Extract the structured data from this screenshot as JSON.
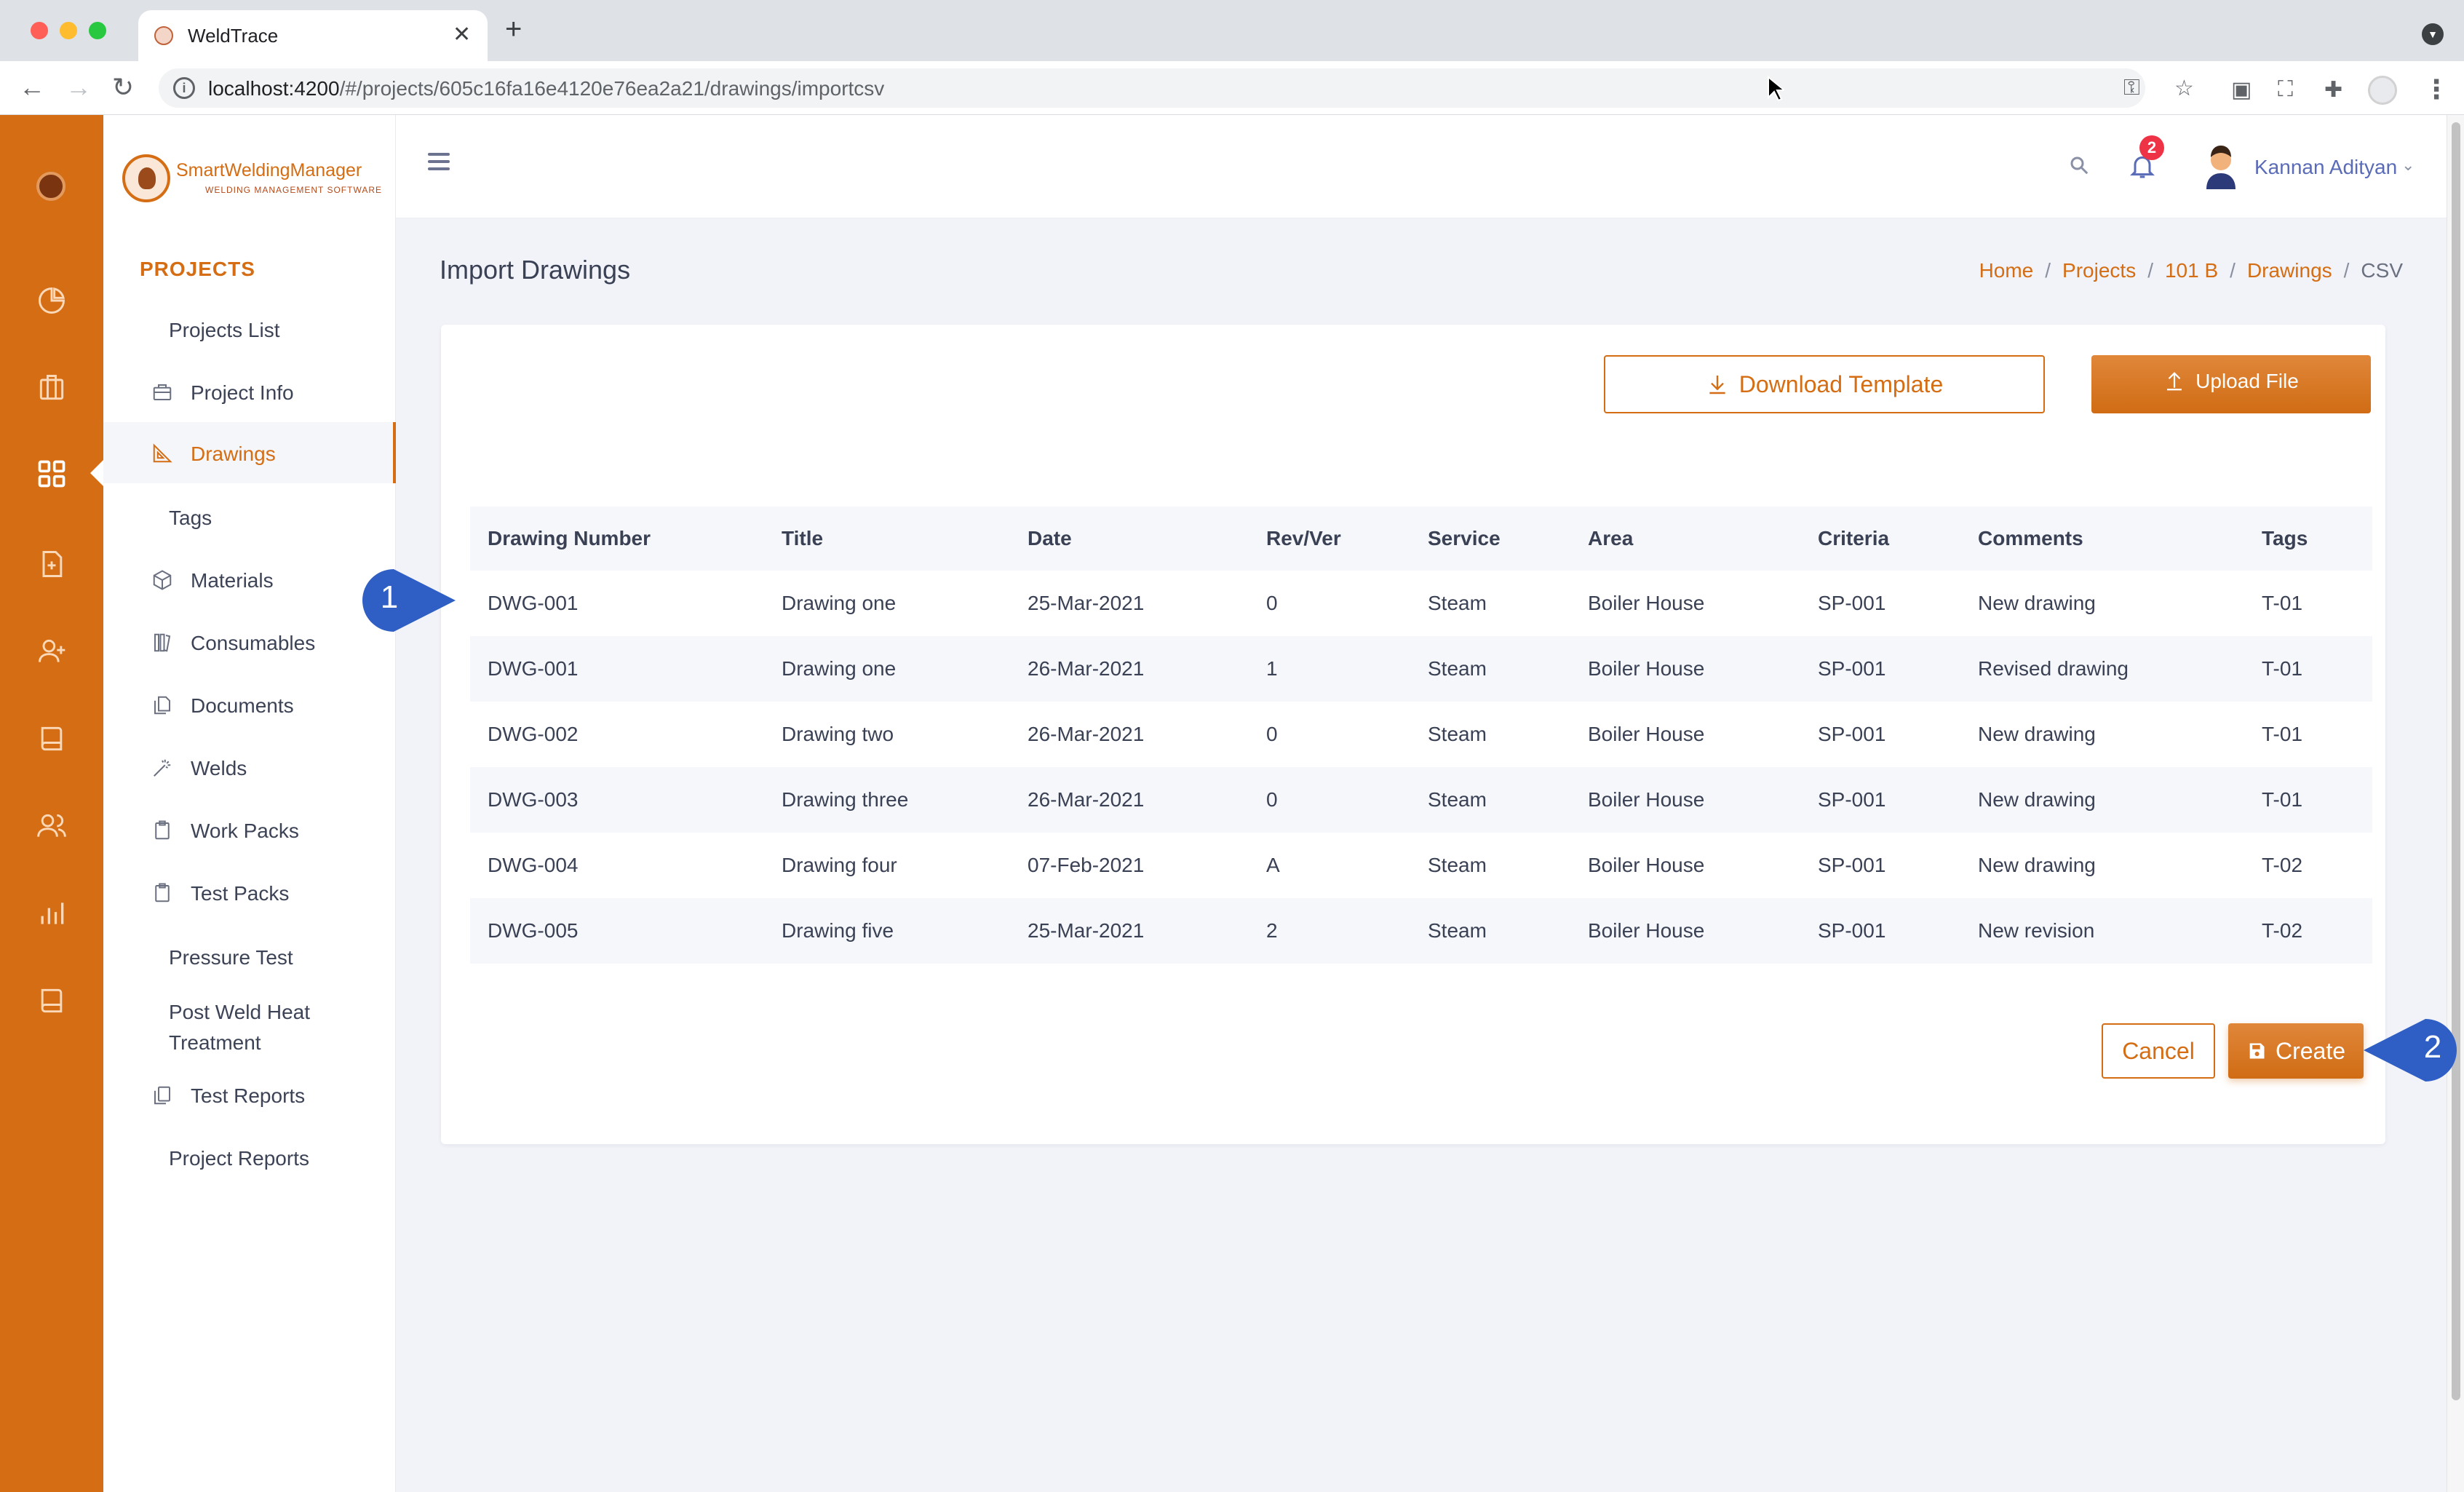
{
  "browser": {
    "tab_title": "WeldTrace",
    "url_host": "localhost:4200",
    "url_path": "/#/projects/605c16fa16e4120e76ea2a21/drawings/importcsv"
  },
  "brand": {
    "name": "SmartWeldingManager",
    "tagline": "WELDING MANAGEMENT SOFTWARE"
  },
  "sidebar": {
    "section_title": "PROJECTS",
    "items": [
      {
        "label": "Projects List",
        "icon": "none"
      },
      {
        "label": "Project Info",
        "icon": "briefcase-icon"
      },
      {
        "label": "Drawings",
        "icon": "ruler-triangle-icon",
        "active": true
      },
      {
        "label": "Tags",
        "icon": "none"
      },
      {
        "label": "Materials",
        "icon": "box-icon"
      },
      {
        "label": "Consumables",
        "icon": "books-icon"
      },
      {
        "label": "Documents",
        "icon": "files-icon"
      },
      {
        "label": "Welds",
        "icon": "magic-wand-icon"
      },
      {
        "label": "Work Packs",
        "icon": "clipboard-icon"
      },
      {
        "label": "Test Packs",
        "icon": "clipboard-icon"
      },
      {
        "label": "Pressure Test",
        "icon": "none"
      },
      {
        "label": "Post Weld Heat Treatment",
        "icon": "none"
      },
      {
        "label": "Test Reports",
        "icon": "copy-icon"
      },
      {
        "label": "Project Reports",
        "icon": "none"
      }
    ]
  },
  "header": {
    "notification_count": "2",
    "user_name": "Kannan Adityan"
  },
  "page": {
    "title": "Import Drawings",
    "breadcrumb": [
      "Home",
      "Projects",
      "101 B",
      "Drawings",
      "CSV"
    ]
  },
  "actions": {
    "download_label": "Download Template",
    "upload_label": "Upload File",
    "cancel_label": "Cancel",
    "create_label": "Create"
  },
  "table": {
    "columns": [
      "Drawing Number",
      "Title",
      "Date",
      "Rev/Ver",
      "Service",
      "Area",
      "Criteria",
      "Comments",
      "Tags"
    ],
    "rows": [
      [
        "DWG-001",
        "Drawing one",
        "25-Mar-2021",
        "0",
        "Steam",
        "Boiler House",
        "SP-001",
        "New drawing",
        "T-01"
      ],
      [
        "DWG-001",
        "Drawing one",
        "26-Mar-2021",
        "1",
        "Steam",
        "Boiler House",
        "SP-001",
        "Revised drawing",
        "T-01"
      ],
      [
        "DWG-002",
        "Drawing two",
        "26-Mar-2021",
        "0",
        "Steam",
        "Boiler House",
        "SP-001",
        "New drawing",
        "T-01"
      ],
      [
        "DWG-003",
        "Drawing three",
        "26-Mar-2021",
        "0",
        "Steam",
        "Boiler House",
        "SP-001",
        "New drawing",
        "T-01"
      ],
      [
        "DWG-004",
        "Drawing four",
        "07-Feb-2021",
        "A",
        "Steam",
        "Boiler House",
        "SP-001",
        "New drawing",
        "T-02"
      ],
      [
        "DWG-005",
        "Drawing five",
        "25-Mar-2021",
        "2",
        "Steam",
        "Boiler House",
        "SP-001",
        "New revision",
        "T-02"
      ]
    ]
  },
  "callouts": [
    "1",
    "2"
  ],
  "colors": {
    "accent": "#d46d13",
    "rail": "#d46d13",
    "content_bg": "#f1f3f8",
    "callout": "#2f5fc4",
    "badge": "#ef3346"
  }
}
